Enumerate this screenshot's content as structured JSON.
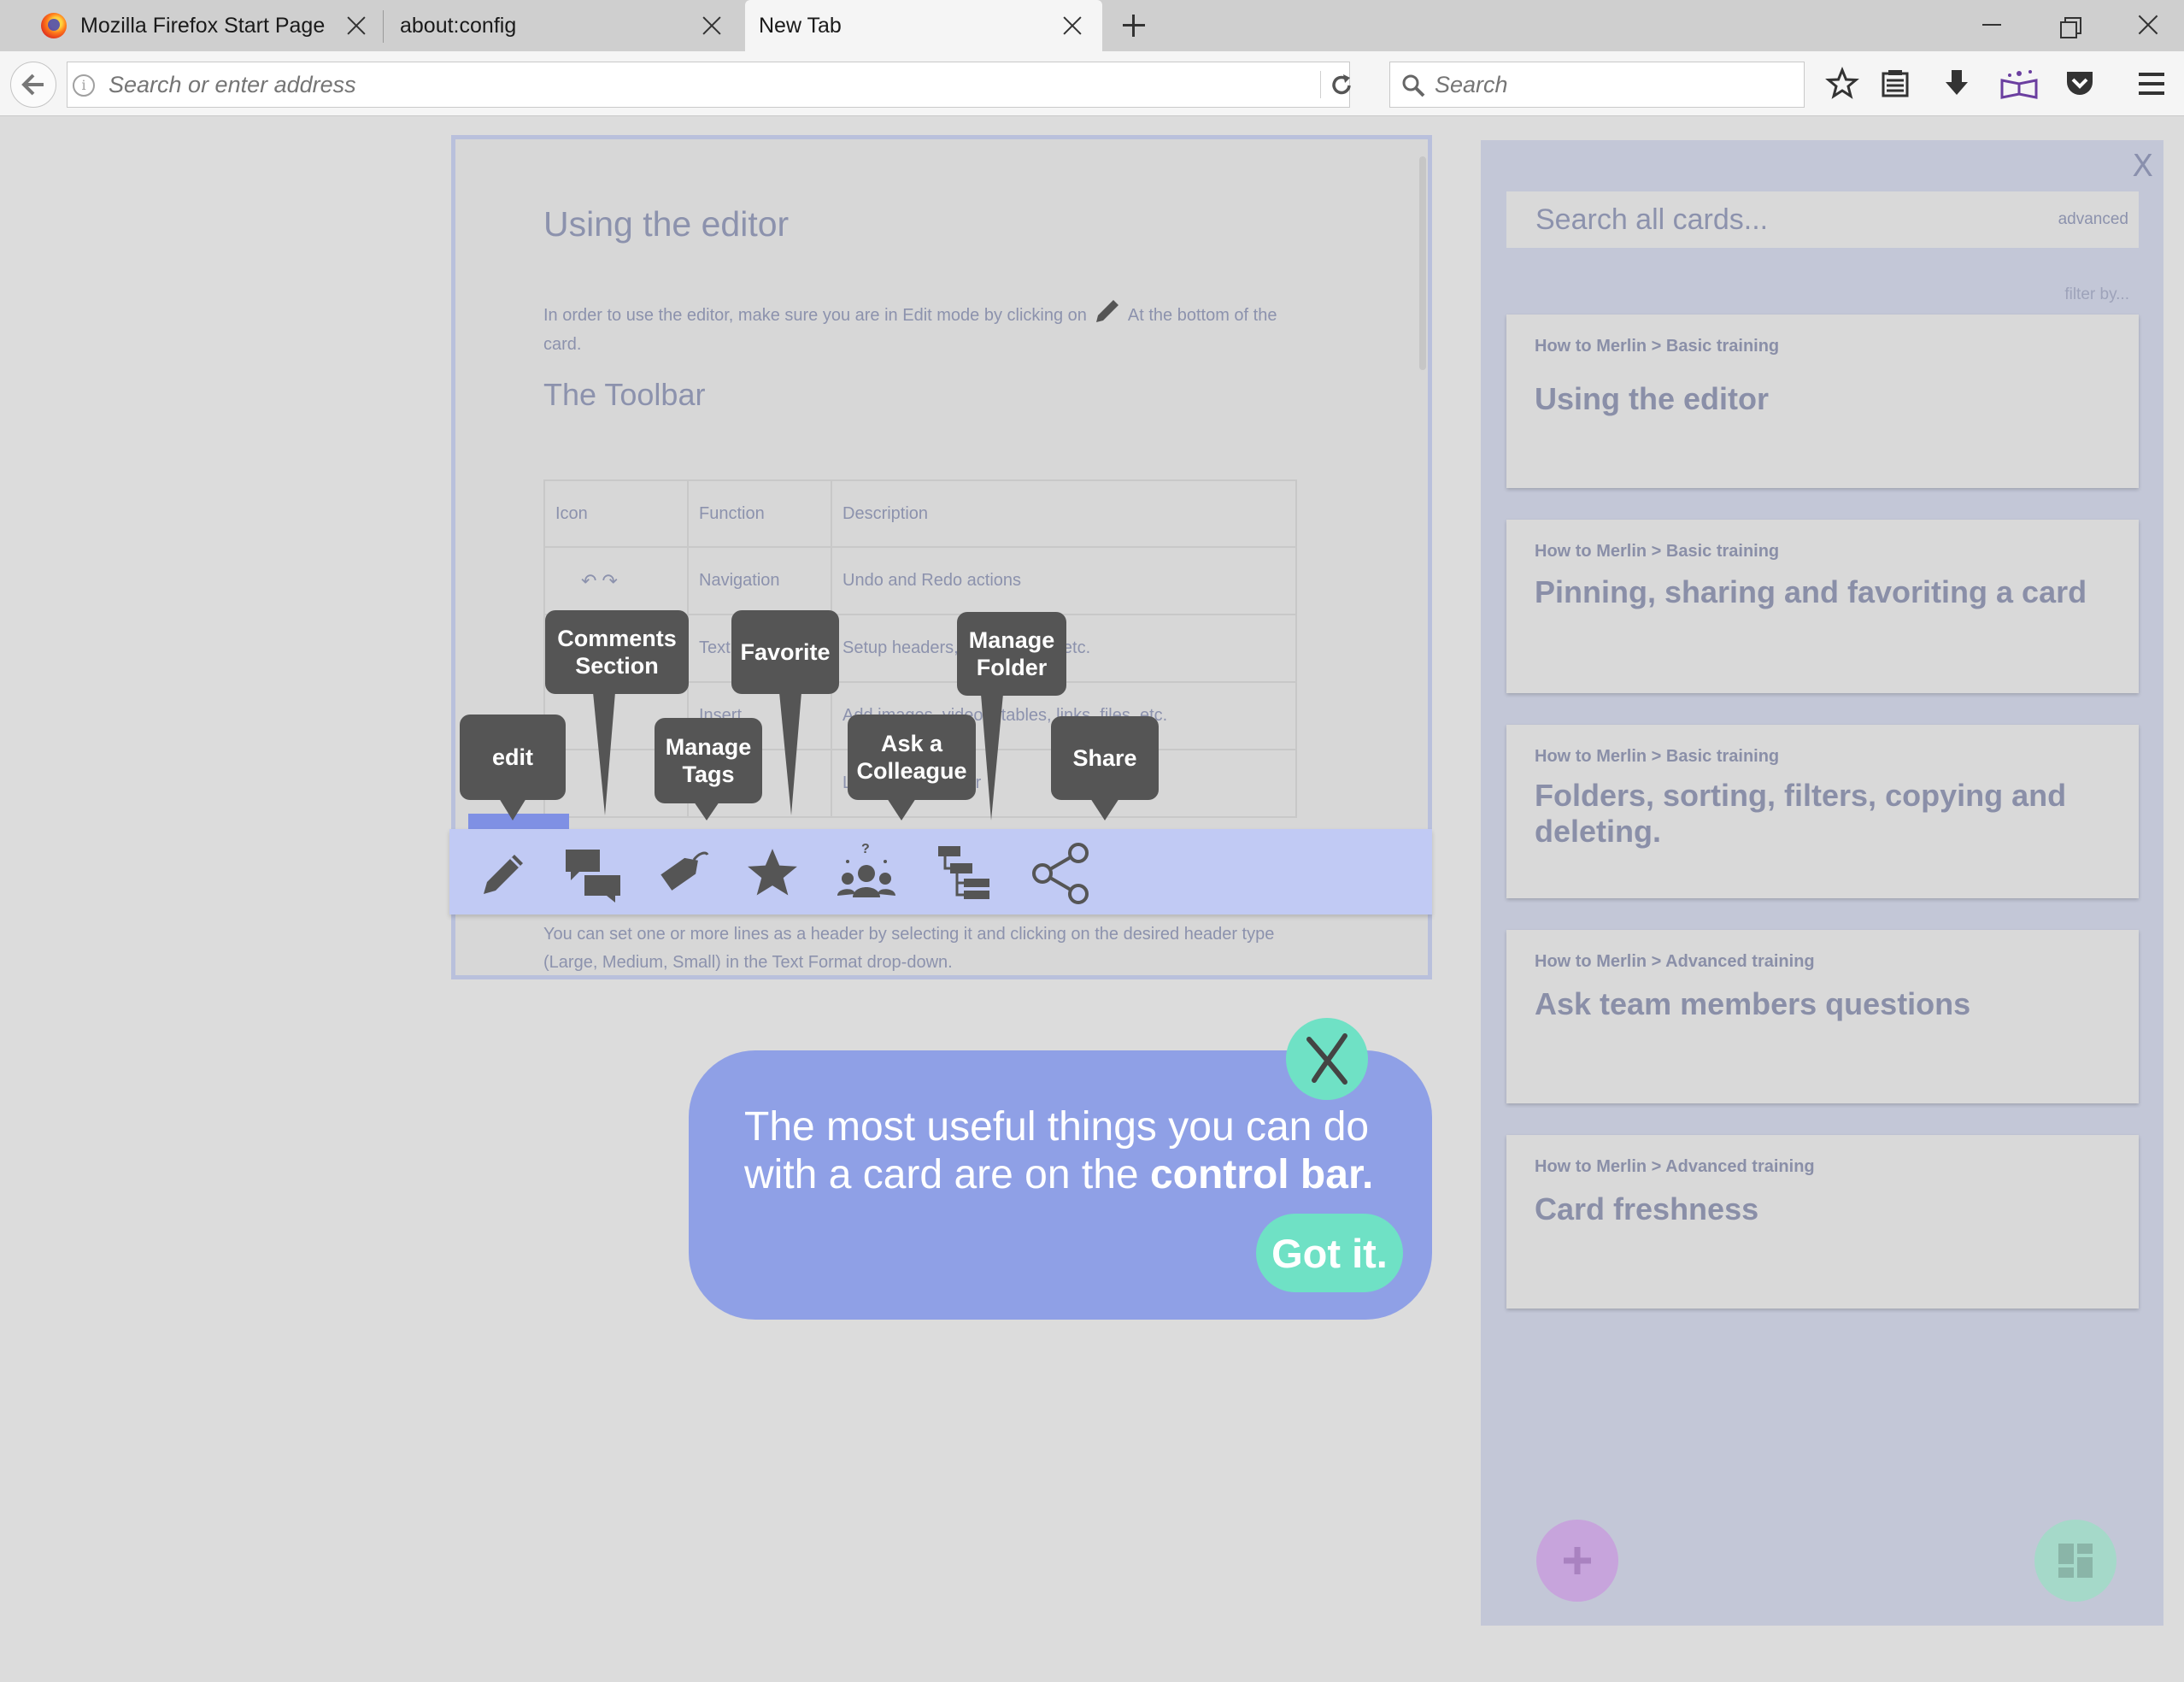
{
  "browser": {
    "tabs": [
      {
        "label": "Mozilla Firefox Start Page"
      },
      {
        "label": "about:config"
      },
      {
        "label": "New Tab"
      }
    ],
    "url_placeholder": "Search or enter address",
    "search_placeholder": "Search"
  },
  "card": {
    "title": "Using the editor",
    "intro_text": "In order to use the editor, make sure you are in Edit mode by clicking on",
    "intro_text_after": "At the bottom of the card.",
    "section_title": "The Toolbar",
    "table": {
      "headers": [
        "Icon",
        "Function",
        "Description"
      ],
      "rows": [
        {
          "function": "Navigation",
          "description": "Undo and Redo actions"
        },
        {
          "function": "Text",
          "description": "Setup headers, lists, quotes, etc."
        },
        {
          "function": "Insert",
          "description": "Add images, videos, tables, links, files, etc."
        },
        {
          "function": "",
          "description": "Learn about editor"
        }
      ]
    },
    "bottom_text": "You can set one or more lines as a header by selecting it and clicking on the desired header type (Large, Medium, Small) in the Text Format drop-down."
  },
  "callouts": {
    "edit": "edit",
    "comments": "Comments Section",
    "tags": "Manage Tags",
    "favorite": "Favorite",
    "colleague": "Ask a Colleague",
    "folder": "Manage Folder",
    "share": "Share"
  },
  "sidebar": {
    "close_label": "X",
    "search_placeholder": "Search all cards...",
    "advanced_label": "advanced",
    "filter_label": "filter by...",
    "cards": [
      {
        "crumb": "How to Merlin > Basic training",
        "title": "Using the editor"
      },
      {
        "crumb": "How to Merlin > Basic training",
        "title": "Pinning, sharing and favoriting a card"
      },
      {
        "crumb": "How to Merlin > Basic training",
        "title": "Folders, sorting, filters, copying and deleting."
      },
      {
        "crumb": "How to Merlin > Advanced training",
        "title": "Ask team members questions"
      },
      {
        "crumb": "How to Merlin > Advanced training",
        "title": "Card freshness"
      }
    ]
  },
  "tour": {
    "text_before": "The most useful things you can do with a card are on the ",
    "text_bold": "control bar.",
    "button_label": "Got it."
  },
  "colors": {
    "accent_blue": "#8fa0e6",
    "accent_green": "#6fe1c5",
    "control_bar": "#c1caf4",
    "callout_bg": "#555555"
  }
}
